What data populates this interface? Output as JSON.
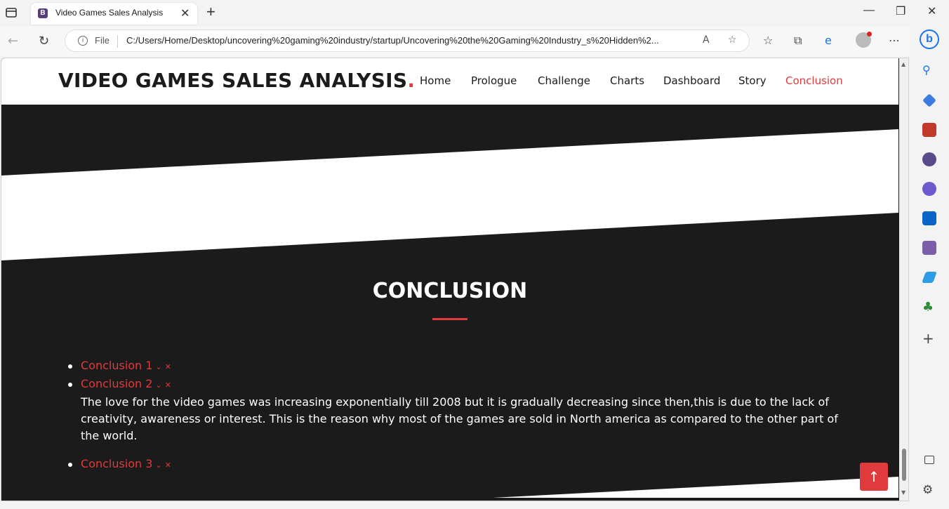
{
  "browser": {
    "tab_title": "Video Games Sales Analysis",
    "favicon_letter": "B",
    "file_label": "File",
    "url": "C:/Users/Home/Desktop/uncovering%20gaming%20industry/startup/Uncovering%20the%20Gaming%20Industry_s%20Hidden%2..."
  },
  "site": {
    "logo_text": "VIDEO GAMES SALES ANALYSIS",
    "logo_dot": ".",
    "nav": [
      {
        "label": "Home"
      },
      {
        "label": "Prologue"
      },
      {
        "label": "Challenge"
      },
      {
        "label": "Charts"
      },
      {
        "label": "Dashboard"
      },
      {
        "label": "Story"
      },
      {
        "label": "Conclusion",
        "active": true
      }
    ]
  },
  "conclusion": {
    "title": "CONCLUSION",
    "items": [
      {
        "heading": "Conclusion 1",
        "toggle_icon": "⌄",
        "close_icon": "✕",
        "body": ""
      },
      {
        "heading": "Conclusion 2",
        "toggle_icon": "⌄",
        "close_icon": "✕",
        "body": "The love for the video games was increasing exponentially till 2008 but it is gradually decreasing since then,this is due to the lack of creativity, awareness or interest. This is the reason why most of the games are sold in North america as compared to the other part of the world."
      },
      {
        "heading": "Conclusion 3",
        "toggle_icon": "⌄",
        "close_icon": "✕",
        "body": ""
      }
    ]
  },
  "colors": {
    "accent": "#e03a3c",
    "dark": "#1b1b1c",
    "white": "#ffffff"
  },
  "icons": {
    "back_to_top": "↑"
  }
}
